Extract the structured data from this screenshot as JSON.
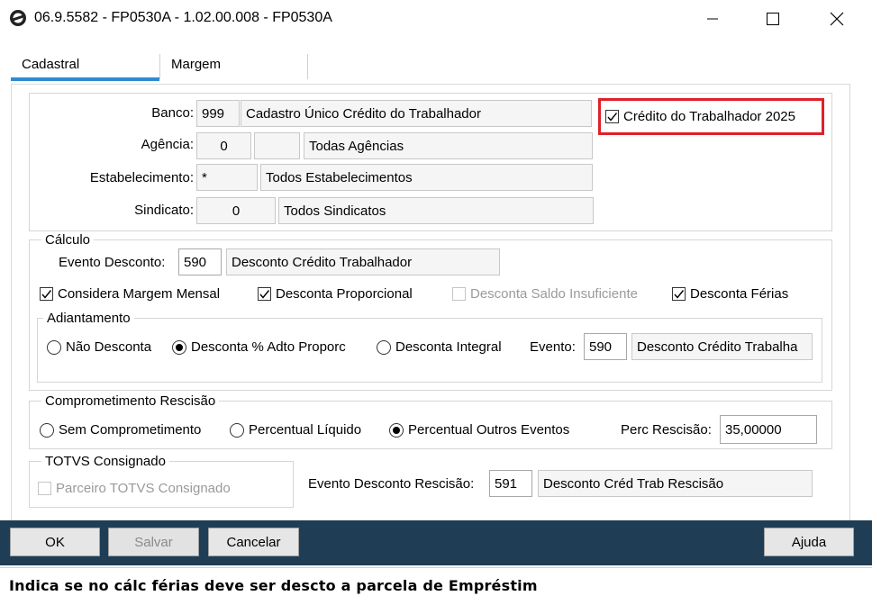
{
  "window": {
    "title": "06.9.5582 - FP0530A - 1.02.00.008 - FP0530A",
    "minimize_glyph": "—",
    "maximize_glyph": "☐",
    "close_glyph": "✕"
  },
  "tabs": [
    {
      "label": "Cadastral",
      "active": true
    },
    {
      "label": "Margem",
      "active": false
    }
  ],
  "top_section": {
    "banco": {
      "label": "Banco:",
      "code": "999",
      "description": "Cadastro  Único  Crédito do Trabalhador"
    },
    "agencia": {
      "label": "Agência:",
      "code": "0",
      "code2": "",
      "description": "Todas Agências"
    },
    "estabelecimento": {
      "label": "Estabelecimento:",
      "code": "*",
      "description": "Todos Estabelecimentos"
    },
    "sindicato": {
      "label": "Sindicato:",
      "code": "0",
      "description": "Todos Sindicatos"
    },
    "credito_checkbox": {
      "label": "Crédito do Trabalhador 2025",
      "checked": true
    }
  },
  "calculo": {
    "legend": "Cálculo",
    "evento_label": "Evento Desconto:",
    "evento_code": "590",
    "evento_desc": "Desconto Crédito Trabalhador",
    "checkboxes": [
      {
        "label": "Considera Margem Mensal",
        "checked": true,
        "enabled": true
      },
      {
        "label": "Desconta Proporcional",
        "checked": true,
        "enabled": true
      },
      {
        "label": "Desconta Saldo Insuficiente",
        "checked": false,
        "enabled": false
      },
      {
        "label": "Desconta Férias",
        "checked": true,
        "enabled": true
      }
    ],
    "adiantamento": {
      "legend": "Adiantamento",
      "options": [
        {
          "label": "Não Desconta",
          "selected": false
        },
        {
          "label": "Desconta % Adto Proporc",
          "selected": true
        },
        {
          "label": "Desconta Integral",
          "selected": false
        }
      ],
      "evento_label": "Evento:",
      "evento_code": "590",
      "evento_desc": "Desconto Crédito Trabalha"
    }
  },
  "comprometimento": {
    "legend": "Comprometimento Rescisão",
    "options": [
      {
        "label": "Sem Comprometimento",
        "selected": false
      },
      {
        "label": "Percentual Líquido",
        "selected": false
      },
      {
        "label": "Percentual Outros Eventos",
        "selected": true
      }
    ],
    "perc_label": "Perc Rescisão:",
    "perc_value": "35,00000"
  },
  "totvs": {
    "legend": "TOTVS Consignado",
    "checkbox_label": "Parceiro TOTVS Consignado",
    "checked": false,
    "enabled": false
  },
  "rescisao": {
    "label": "Evento Desconto Rescisão:",
    "code": "591",
    "desc": "Desconto Créd Trab Rescisão"
  },
  "buttons": {
    "ok": "OK",
    "salvar": "Salvar",
    "cancelar": "Cancelar",
    "ajuda": "Ajuda"
  },
  "status_bar": "Indica se no cálc férias deve ser descto a parcela de Empréstim",
  "colors": {
    "accent": "#2e8bd1",
    "footer": "#1f3d55",
    "highlight": "#e0202a"
  }
}
